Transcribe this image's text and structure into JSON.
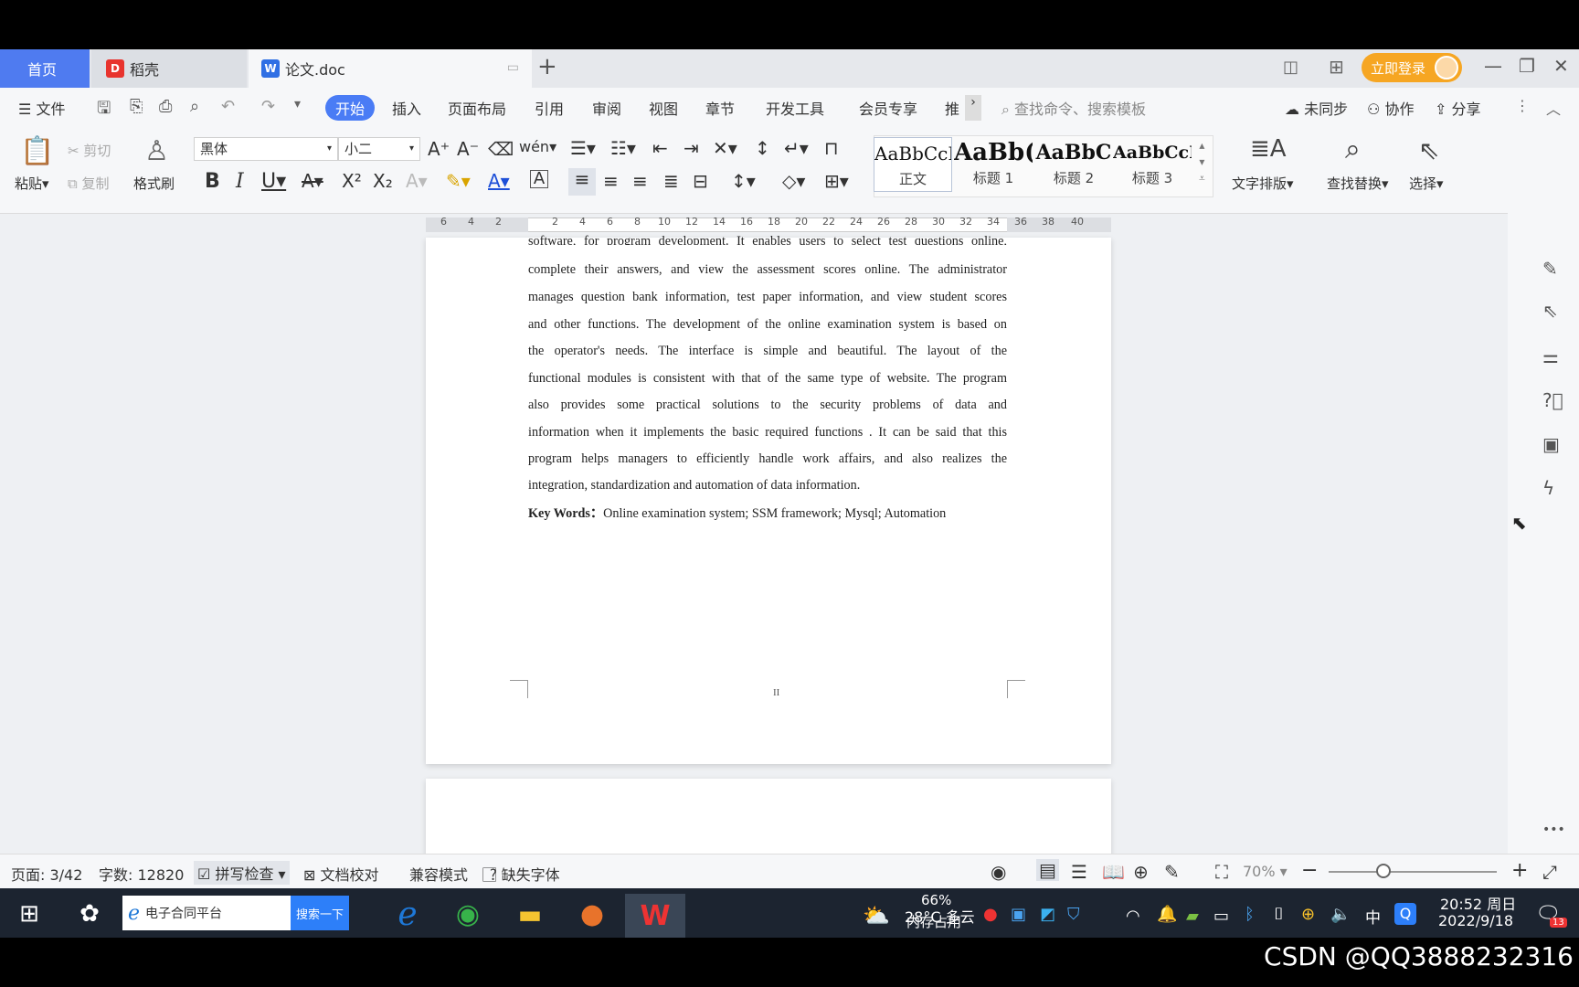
{
  "tabs": {
    "home": "首页",
    "daoke": "稻壳",
    "doc": "论文.doc",
    "add": "+"
  },
  "header": {
    "login": "立即登录"
  },
  "menu": {
    "file": "文件",
    "items": [
      "开始",
      "插入",
      "页面布局",
      "引用",
      "审阅",
      "视图",
      "章节",
      "开发工具",
      "会员专享",
      "推"
    ],
    "search_placeholder": "查找命令、搜索模板",
    "unsynced": "未同步",
    "collab": "协作",
    "share": "分享"
  },
  "ribbon": {
    "paste": "粘贴",
    "cut": "剪切",
    "copy": "复制",
    "format_painter": "格式刷",
    "font_name": "黑体",
    "font_size": "小二",
    "styles": [
      {
        "sample": "AaBbCcI",
        "label": "正文"
      },
      {
        "sample": "AaBb(",
        "label": "标题 1"
      },
      {
        "sample": "AaBbC",
        "label": "标题 2"
      },
      {
        "sample": "AaBbCcI",
        "label": "标题 3"
      }
    ],
    "text_layout": "文字排版",
    "find_replace": "查找替换",
    "select": "选择"
  },
  "ruler": {
    "ticks": [
      "6",
      "4",
      "2",
      "2",
      "4",
      "6",
      "8",
      "10",
      "12",
      "14",
      "16",
      "18",
      "20",
      "22",
      "24",
      "26",
      "28",
      "30",
      "32",
      "34",
      "36",
      "38",
      "40"
    ]
  },
  "document": {
    "lines": [
      "software, for program development. It enables users to select test questions online,",
      "complete their answers, and view the assessment scores online. The administrator",
      "manages question bank information, test paper information, and view student scores",
      "and other functions. The development of the online examination system is based on",
      "the operator's needs. The interface is simple and beautiful. The layout of the",
      "functional modules is consistent with that of the same type of website. The program",
      "also provides some practical solutions to the security problems of data and",
      "information when it implements the basic required functions . It can be said that this",
      "program helps managers to efficiently handle work affairs, and also realizes the",
      "integration, standardization and automation of data information."
    ],
    "keywords_label": "Key Words：",
    "keywords": "Online examination system; SSM framework; Mysql; Automation",
    "page_footer": "II"
  },
  "status": {
    "page": "页面: 3/42",
    "words": "字数: 12820",
    "spell": "拼写检查",
    "proof": "文档校对",
    "compat": "兼容模式",
    "missing_font": "缺失字体",
    "zoom": "70%"
  },
  "taskbar": {
    "search_text": "电子合同平台",
    "search_button": "搜索一下",
    "weather_temp": "28°C 多云",
    "mem": "66%",
    "mem_label": "内存占用",
    "ime": "中",
    "time": "20:52 周日",
    "date": "2022/9/18",
    "notif_count": "13"
  },
  "watermark": "CSDN @QQ3888232316"
}
